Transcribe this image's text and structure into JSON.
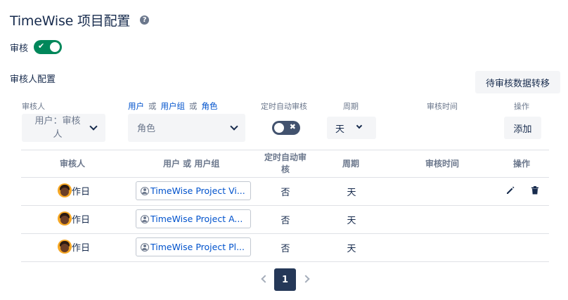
{
  "header": {
    "title": "TimeWise 项目配置",
    "help_icon": "question-circle-icon"
  },
  "review": {
    "label": "审核",
    "enabled": true
  },
  "config": {
    "section_label": "审核人配置",
    "migrate_button": "待审核数据转移"
  },
  "filters": {
    "reviewer_label": "审核人",
    "reviewer_value": "用户：审核人",
    "target_label_parts": [
      "用户",
      "或",
      "用户组",
      "或",
      "角色"
    ],
    "target_value": "角色",
    "auto_label": "定时自动审核",
    "period_label": "周期",
    "period_value": "天",
    "time_label": "审核时间",
    "action_label": "操作",
    "add_button": "添加"
  },
  "table": {
    "headers": {
      "reviewer": "审核人",
      "target": "用户 或 用户组",
      "auto": "定时自动审核",
      "period": "周期",
      "time": "审核时间",
      "action": "操作"
    },
    "rows": [
      {
        "reviewer": "作日",
        "target": "TimeWise Project Vi...",
        "auto": "否",
        "period": "天",
        "time": ""
      },
      {
        "reviewer": "作日",
        "target": "TimeWise Project A...",
        "auto": "否",
        "period": "天",
        "time": ""
      },
      {
        "reviewer": "作日",
        "target": "TimeWise Project Pl...",
        "auto": "否",
        "period": "天",
        "time": ""
      }
    ]
  },
  "pagination": {
    "current": "1"
  },
  "colors": {
    "accent": "#0052cc",
    "toggle_on": "#00875a",
    "toggle_off": "#42526e",
    "page_active": "#253858"
  }
}
